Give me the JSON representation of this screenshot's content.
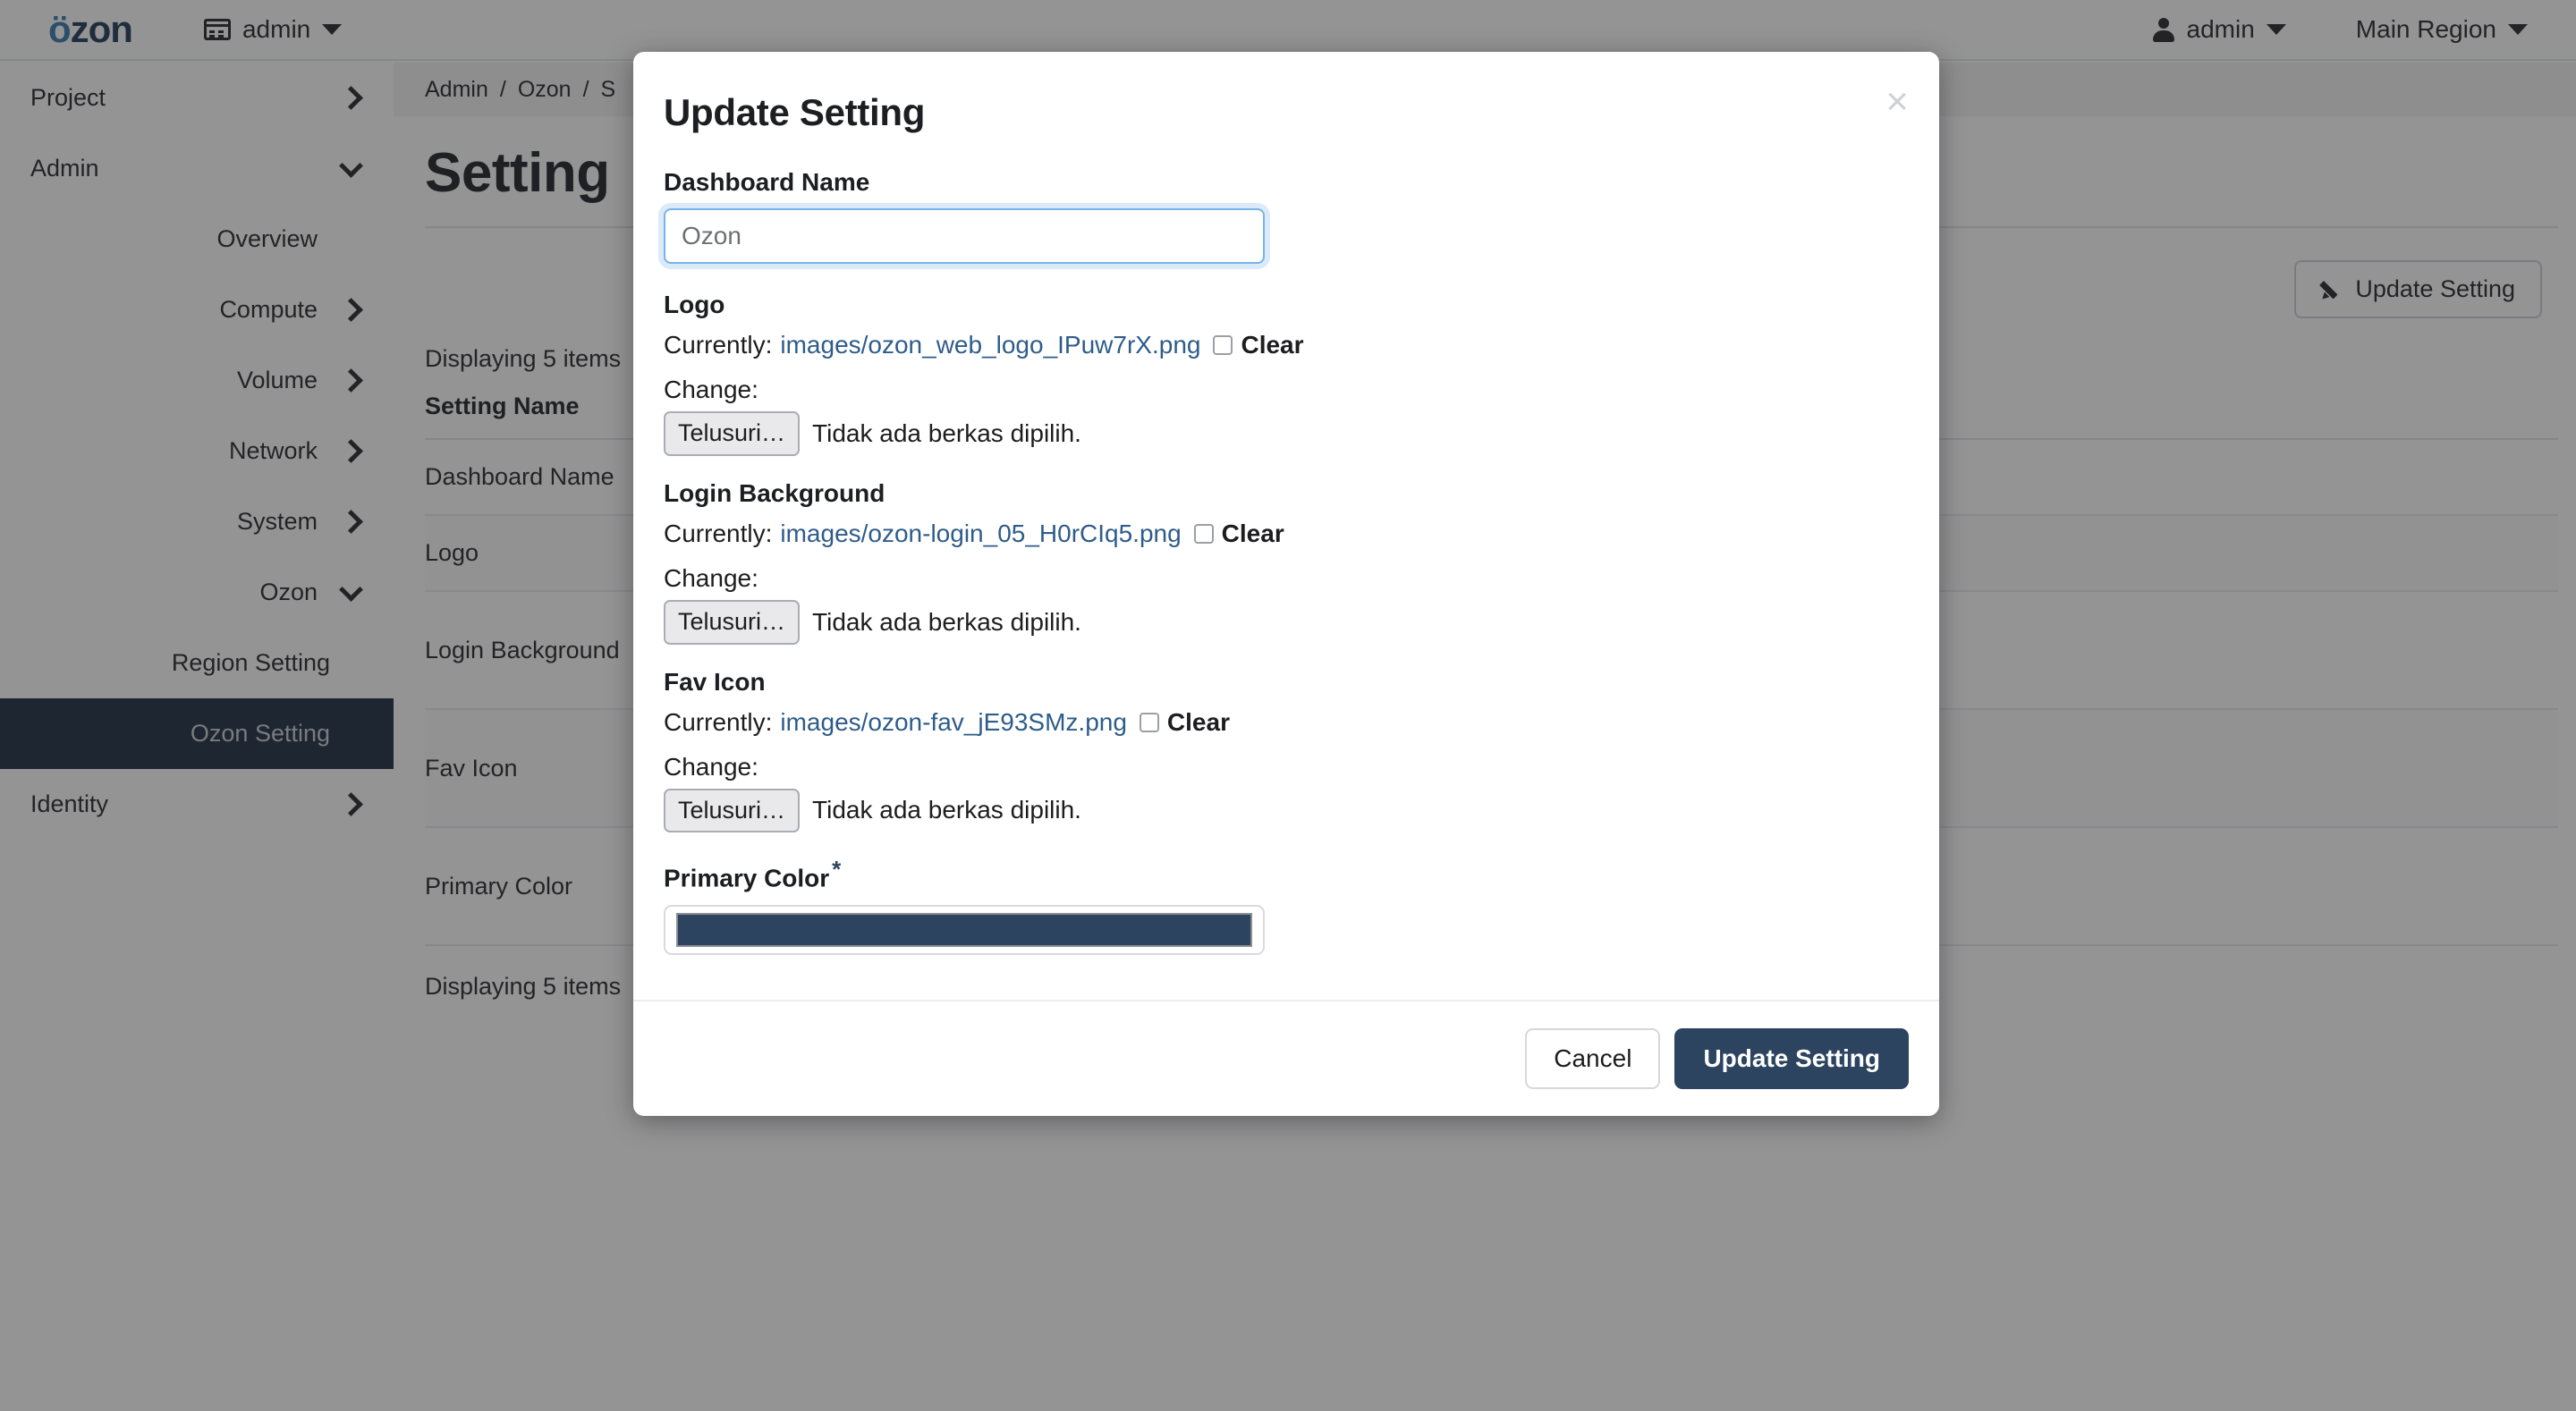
{
  "navbar": {
    "brand_dots": "ö",
    "brand_rest": "zon",
    "project_menu": "admin",
    "user_menu": "admin",
    "region_menu": "Main Region"
  },
  "sidebar": {
    "items": [
      {
        "label": "Project",
        "level": 0,
        "chevron": "right",
        "active": false
      },
      {
        "label": "Admin",
        "level": 0,
        "chevron": "down",
        "active": false
      },
      {
        "label": "Overview",
        "level": 1,
        "chevron": "none",
        "active": false
      },
      {
        "label": "Compute",
        "level": 1,
        "chevron": "right",
        "active": false
      },
      {
        "label": "Volume",
        "level": 1,
        "chevron": "right",
        "active": false
      },
      {
        "label": "Network",
        "level": 1,
        "chevron": "right",
        "active": false
      },
      {
        "label": "System",
        "level": 1,
        "chevron": "right",
        "active": false
      },
      {
        "label": "Ozon",
        "level": 1,
        "chevron": "down",
        "active": false
      },
      {
        "label": "Region Setting",
        "level": 2,
        "chevron": "none",
        "active": false
      },
      {
        "label": "Ozon Setting",
        "level": 2,
        "chevron": "none",
        "active": true
      },
      {
        "label": "Identity",
        "level": 0,
        "chevron": "right",
        "active": false
      }
    ]
  },
  "main": {
    "breadcrumb": [
      "Admin",
      "Ozon",
      "S"
    ],
    "page_title": "Setting",
    "update_button": "Update Setting",
    "displaying_top": "Displaying 5 items",
    "displaying_bottom": "Displaying 5 items",
    "table": {
      "header": "Setting Name",
      "rows": [
        "Dashboard Name",
        "Logo",
        "Login Background",
        "Fav Icon",
        "Primary Color"
      ]
    }
  },
  "modal": {
    "title": "Update Setting",
    "close_glyph": "×",
    "fields": {
      "dashboard_name": {
        "label": "Dashboard Name",
        "value": "Ozon",
        "placeholder": "Ozon"
      },
      "logo": {
        "label": "Logo",
        "currently_label": "Currently:",
        "currently_file": "images/ozon_web_logo_IPuw7rX.png",
        "clear_label": "Clear",
        "change_label": "Change:",
        "browse_button": "Telusuri…",
        "no_file_text": "Tidak ada berkas dipilih."
      },
      "login_background": {
        "label": "Login Background",
        "currently_label": "Currently:",
        "currently_file": "images/ozon-login_05_H0rCIq5.png",
        "clear_label": "Clear",
        "change_label": "Change:",
        "browse_button": "Telusuri…",
        "no_file_text": "Tidak ada berkas dipilih."
      },
      "fav_icon": {
        "label": "Fav Icon",
        "currently_label": "Currently:",
        "currently_file": "images/ozon-fav_jE93SMz.png",
        "clear_label": "Clear",
        "change_label": "Change:",
        "browse_button": "Telusuri…",
        "no_file_text": "Tidak ada berkas dipilih."
      },
      "primary_color": {
        "label": "Primary Color",
        "required_marker": "*",
        "value": "#2C4460"
      }
    },
    "footer": {
      "cancel": "Cancel",
      "submit": "Update Setting"
    }
  },
  "colors": {
    "primary": "#2C4460",
    "sidebar_active": "#132339",
    "link": "#2E5C8A",
    "brand_accent": "#2F73A8",
    "overlay": "rgba(41,41,43,0.50)"
  }
}
